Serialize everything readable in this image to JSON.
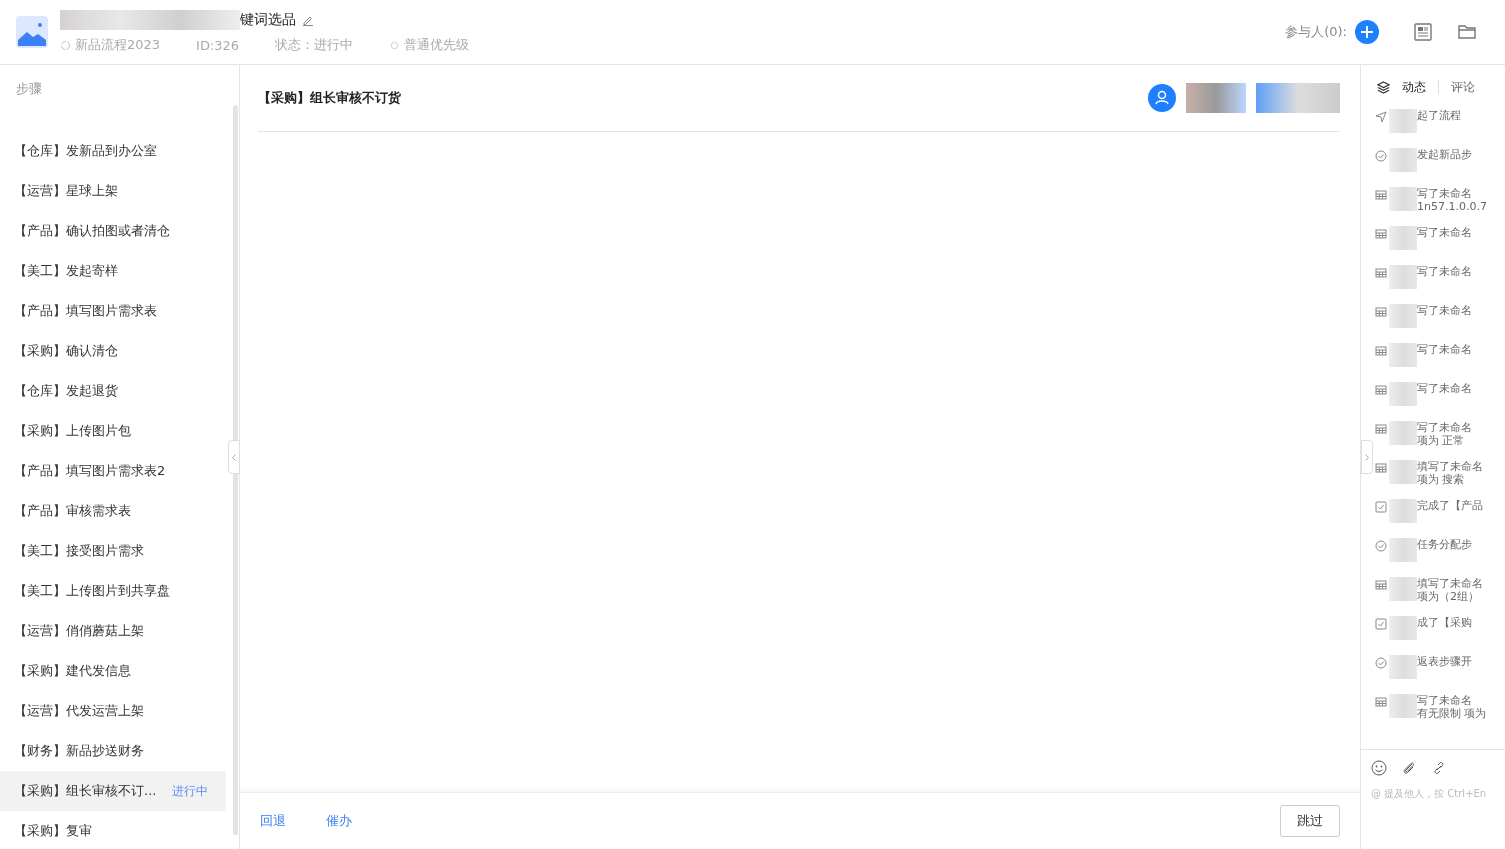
{
  "header": {
    "title_suffix": "键词选品",
    "flow": "新品流程2023",
    "id": "ID:326",
    "status": "状态：进行中",
    "priority": "普通优先级",
    "participants": "参与人(0):"
  },
  "sidebar": {
    "heading": "步骤",
    "items": [
      {
        "label": "【仓库】发新品到办公室",
        "selected": false
      },
      {
        "label": "【运营】星球上架",
        "selected": false
      },
      {
        "label": "【产品】确认拍图或者清仓",
        "selected": false
      },
      {
        "label": "【美工】发起寄样",
        "selected": false
      },
      {
        "label": "【产品】填写图片需求表",
        "selected": false
      },
      {
        "label": "【采购】确认清仓",
        "selected": false
      },
      {
        "label": "【仓库】发起退货",
        "selected": false
      },
      {
        "label": "【采购】上传图片包",
        "selected": false
      },
      {
        "label": "【产品】填写图片需求表2",
        "selected": false
      },
      {
        "label": "【产品】审核需求表",
        "selected": false
      },
      {
        "label": "【美工】接受图片需求",
        "selected": false
      },
      {
        "label": "【美工】上传图片到共享盘",
        "selected": false
      },
      {
        "label": "【运营】俏俏蘑菇上架",
        "selected": false
      },
      {
        "label": "【采购】建代发信息",
        "selected": false
      },
      {
        "label": "【运营】代发运营上架",
        "selected": false
      },
      {
        "label": "【财务】新品抄送财务",
        "selected": false
      },
      {
        "label": "【采购】组长审核不订...",
        "selected": true,
        "status": "进行中"
      },
      {
        "label": "【采购】复审",
        "selected": false
      }
    ]
  },
  "main": {
    "title": "【采购】组长审核不订货",
    "actions": [
      "回退",
      "催办"
    ],
    "skip": "跳过"
  },
  "activity": {
    "tabs": [
      {
        "label": "动态",
        "selected": true
      },
      {
        "label": "评论",
        "selected": false
      }
    ],
    "items": [
      {
        "kind": "send",
        "lines": [
          "起了流程"
        ]
      },
      {
        "kind": "circle",
        "lines": [
          "发起新品步"
        ]
      },
      {
        "kind": "table",
        "lines": [
          "写了未命名",
          "1n57.1.0.0.7"
        ]
      },
      {
        "kind": "table",
        "lines": [
          "写了未命名"
        ]
      },
      {
        "kind": "table",
        "lines": [
          "写了未命名"
        ]
      },
      {
        "kind": "table",
        "lines": [
          "写了未命名"
        ]
      },
      {
        "kind": "table",
        "lines": [
          "写了未命名"
        ]
      },
      {
        "kind": "table",
        "lines": [
          "写了未命名"
        ]
      },
      {
        "kind": "table",
        "lines": [
          "写了未命名",
          "项为 正常"
        ]
      },
      {
        "kind": "table",
        "lines": [
          "填写了未命名",
          "项为 搜索"
        ]
      },
      {
        "kind": "box",
        "lines": [
          "完成了【产品"
        ]
      },
      {
        "kind": "circle",
        "lines": [
          "任务分配步"
        ]
      },
      {
        "kind": "table",
        "lines": [
          "填写了未命名",
          "项为（2组）"
        ]
      },
      {
        "kind": "box",
        "lines": [
          "成了【采购"
        ]
      },
      {
        "kind": "circle",
        "lines": [
          "返表步骤开"
        ]
      },
      {
        "kind": "table",
        "lines": [
          "写了未命名",
          "有无限制 项为"
        ]
      }
    ],
    "placeholder": "@ 提及他人，按 Ctrl+En"
  }
}
